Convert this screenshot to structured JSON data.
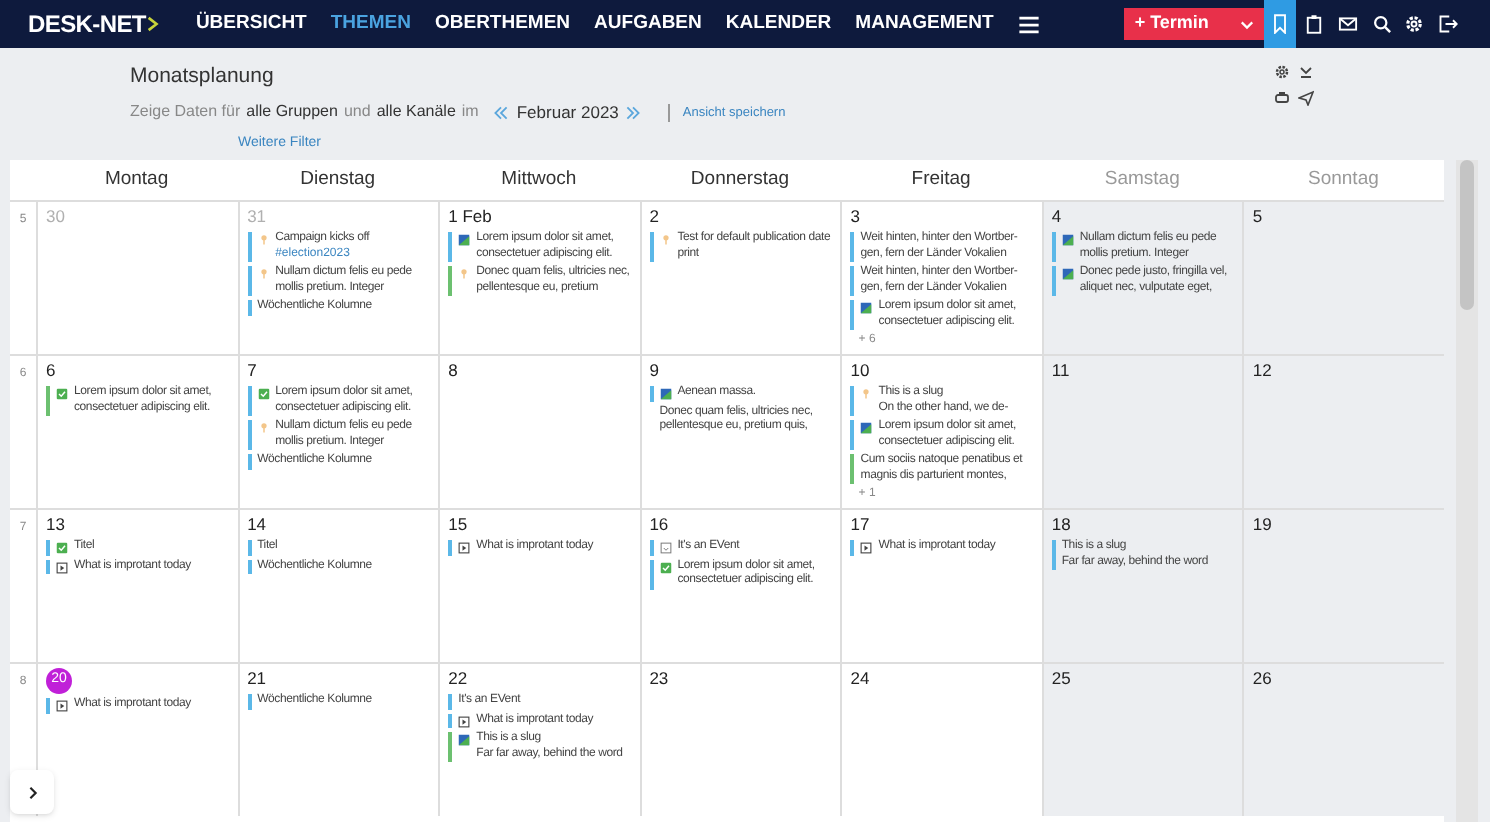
{
  "nav": {
    "logo": "DESK-NET",
    "items": [
      {
        "label": "ÜBERSICHT",
        "selected": false
      },
      {
        "label": "THEMEN",
        "selected": true
      },
      {
        "label": "OBERTHEMEN",
        "selected": false
      },
      {
        "label": "AUFGABEN",
        "selected": false
      },
      {
        "label": "KALENDER",
        "selected": false
      },
      {
        "label": "MANAGEMENT",
        "selected": false
      }
    ],
    "new_button": "+ Termin",
    "tools": [
      {
        "kind": "bookmark",
        "selected": true
      },
      {
        "kind": "clipboard",
        "selected": false
      },
      {
        "kind": "mail",
        "selected": false
      },
      {
        "kind": "search",
        "selected": false
      },
      {
        "kind": "settings",
        "selected": false
      },
      {
        "kind": "logout",
        "selected": false
      }
    ]
  },
  "header": {
    "title": "Monatsplanung",
    "filter": [
      {
        "text": "Zeige Daten für",
        "strong": false
      },
      {
        "text": "alle Gruppen",
        "strong": true
      },
      {
        "text": "und",
        "strong": false
      },
      {
        "text": "alle Kanäle",
        "strong": true
      },
      {
        "text": "im",
        "strong": false
      }
    ],
    "month": "Februar 2023",
    "save_view": "Ansicht speichern",
    "more_filters": "Weitere Filter"
  },
  "calendar": {
    "columns": [
      {
        "label": "Montag",
        "weekend": false
      },
      {
        "label": "Dienstag",
        "weekend": false
      },
      {
        "label": "Mittwoch",
        "weekend": false
      },
      {
        "label": "Donnerstag",
        "weekend": false
      },
      {
        "label": "Freitag",
        "weekend": false
      },
      {
        "label": "Samstag",
        "weekend": true
      },
      {
        "label": "Sonntag",
        "weekend": true
      }
    ],
    "weeks": [
      {
        "number": "5",
        "days": [
          {
            "label": "30",
            "kind": "outside"
          },
          {
            "label": "31",
            "kind": "outside",
            "entries": [
              {
                "kind": "pin",
                "color": "#5bb8e8",
                "text": "Campaign kicks off",
                "tag": "#election2023"
              },
              {
                "kind": "pin",
                "color": "#5bb8e8",
                "text": "Nullam dictum felis eu pede mollis pretium. Integer"
              },
              {
                "color": "#5bb8e8",
                "text": "Wöchentliche Kolumne"
              }
            ]
          },
          {
            "label": "1 Feb",
            "kind": "inside",
            "entries": [
              {
                "kind": "image",
                "color": "#5bb8e8",
                "text": "Lorem ipsum dolor sit amet, consectetuer adipiscing elit."
              },
              {
                "kind": "pin",
                "color": "#6cc070",
                "text": "Donec quam felis, ultricies nec, pellentesque eu, pretium"
              }
            ]
          },
          {
            "label": "2",
            "kind": "inside",
            "entries": [
              {
                "kind": "pin",
                "color": "#5bb8e8",
                "text": "Test for default publication date print"
              }
            ]
          },
          {
            "label": "3",
            "kind": "inside",
            "entries": [
              {
                "color": "#5bb8e8",
                "text": "Weit hinten, hinter den Wortber-gen, fern der Länder Vokalien"
              },
              {
                "color": "#5bb8e8",
                "text": "Weit hinten, hinter den Wortber-gen, fern der Länder Vokalien"
              },
              {
                "kind": "image",
                "color": "#5bb8e8",
                "text": "Lorem ipsum dolor sit amet, consectetuer adipiscing elit."
              }
            ],
            "more": "+ 6"
          },
          {
            "label": "4",
            "kind": "inside",
            "entries": [
              {
                "kind": "image",
                "color": "#5bb8e8",
                "text": "Nullam dictum felis eu pede mollis pretium. Integer"
              },
              {
                "kind": "image",
                "color": "#5bb8e8",
                "text": "Donec pede justo, fringilla vel, aliquet nec, vulputate eget,"
              }
            ]
          },
          {
            "label": "5",
            "kind": "inside"
          }
        ]
      },
      {
        "number": "6",
        "days": [
          {
            "label": "6",
            "kind": "inside",
            "entries": [
              {
                "kind": "check",
                "color": "#6cc070",
                "text": "Lorem ipsum dolor sit amet, consectetuer adipiscing elit."
              }
            ]
          },
          {
            "label": "7",
            "kind": "inside",
            "entries": [
              {
                "kind": "check",
                "color": "#5bb8e8",
                "text": "Lorem ipsum dolor sit amet, consectetuer adipiscing elit."
              },
              {
                "kind": "pin",
                "color": "#5bb8e8",
                "text": "Nullam dictum felis eu pede mollis pretium. Integer"
              },
              {
                "color": "#5bb8e8",
                "text": "Wöchentliche Kolumne"
              }
            ]
          },
          {
            "label": "8",
            "kind": "inside"
          },
          {
            "label": "9",
            "kind": "inside",
            "entries": [
              {
                "kind": "image",
                "color": "#5bb8e8",
                "text": "Aenean massa."
              },
              {
                "text": "Donec quam felis, ultricies nec, pellentesque eu, pretium quis,"
              }
            ]
          },
          {
            "label": "10",
            "kind": "inside",
            "entries": [
              {
                "kind": "pin",
                "color": "#5bb8e8",
                "text": "This is a slug",
                "subtext": "On the other hand, we de-"
              },
              {
                "kind": "image",
                "color": "#5bb8e8",
                "text": "Lorem ipsum dolor sit amet, consectetuer adipiscing elit."
              },
              {
                "color": "#6cc070",
                "text": "Cum sociis natoque penatibus et magnis dis parturient montes,"
              }
            ],
            "more": "+ 1"
          },
          {
            "label": "11",
            "kind": "inside"
          },
          {
            "label": "12",
            "kind": "inside"
          }
        ]
      },
      {
        "number": "7",
        "days": [
          {
            "label": "13",
            "kind": "inside",
            "entries": [
              {
                "kind": "check",
                "color": "#5bb8e8",
                "text": "Titel"
              },
              {
                "kind": "video",
                "color": "#5bb8e8",
                "text": "What is improtant today"
              }
            ]
          },
          {
            "label": "14",
            "kind": "inside",
            "entries": [
              {
                "color": "#5bb8e8",
                "text": "Titel"
              },
              {
                "color": "#5bb8e8",
                "text": "Wöchentliche Kolumne"
              }
            ]
          },
          {
            "label": "15",
            "kind": "inside",
            "entries": [
              {
                "kind": "video",
                "color": "#5bb8e8",
                "text": "What is improtant today"
              }
            ]
          },
          {
            "label": "16",
            "kind": "inside",
            "entries": [
              {
                "kind": "event",
                "color": "#5bb8e8",
                "text": "It's an EVent"
              },
              {
                "kind": "check",
                "color": "#5bb8e8",
                "text": "Lorem ipsum dolor sit amet, consectetuer adipiscing elit."
              }
            ]
          },
          {
            "label": "17",
            "kind": "inside",
            "entries": [
              {
                "kind": "video",
                "color": "#5bb8e8",
                "text": "What is improtant today"
              }
            ]
          },
          {
            "label": "18",
            "kind": "inside",
            "entries": [
              {
                "color": "#5bb8e8",
                "text": "This is a slug",
                "subtext": "Far far away, behind the word"
              }
            ]
          },
          {
            "label": "19",
            "kind": "inside"
          }
        ]
      },
      {
        "number": "8",
        "days": [
          {
            "label": "20",
            "kind": "today",
            "entries": [
              {
                "kind": "video",
                "color": "#5bb8e8",
                "text": "What is improtant today"
              }
            ]
          },
          {
            "label": "21",
            "kind": "inside",
            "entries": [
              {
                "color": "#5bb8e8",
                "text": "Wöchentliche Kolumne"
              }
            ]
          },
          {
            "label": "22",
            "kind": "inside",
            "entries": [
              {
                "color": "#5bb8e8",
                "text": "It's an EVent"
              },
              {
                "kind": "video",
                "color": "#5bb8e8",
                "text": "What is improtant today"
              },
              {
                "kind": "image",
                "color": "#6cc070",
                "text": "This is a slug",
                "subtext": "Far far away, behind the word"
              }
            ]
          },
          {
            "label": "23",
            "kind": "inside"
          },
          {
            "label": "24",
            "kind": "inside"
          },
          {
            "label": "25",
            "kind": "inside"
          },
          {
            "label": "26",
            "kind": "inside"
          }
        ]
      }
    ]
  }
}
